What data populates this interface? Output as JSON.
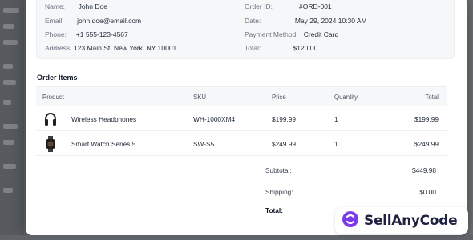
{
  "customer": {
    "name_label": "Name:",
    "name_value": "John Doe",
    "email_label": "Email:",
    "email_value": "john.doe@email.com",
    "phone_label": "Phone:",
    "phone_value": "+1 555-123-4567",
    "address_label": "Address:",
    "address_value": "123 Main St, New York, NY 10001"
  },
  "order": {
    "id_label": "Order ID:",
    "id_value": "#ORD-001",
    "date_label": "Date:",
    "date_value": "May 29, 2024 10:30 AM",
    "payment_label": "Payment Method:",
    "payment_value": "Credit Card",
    "total_label": "Total:",
    "total_value": "$120.00"
  },
  "items_section": {
    "title": "Order Items",
    "headers": {
      "product": "Product",
      "sku": "SKU",
      "price": "Price",
      "quantity": "Quantity",
      "total": "Total"
    },
    "rows": [
      {
        "icon": "headphones-icon",
        "name": "Wireless Headphones",
        "sku": "WH-1000XM4",
        "price": "$199.99",
        "quantity": "1",
        "total": "$199.99"
      },
      {
        "icon": "smartwatch-icon",
        "name": "Smart Watch Series 5",
        "sku": "SW-S5",
        "price": "$249.99",
        "quantity": "1",
        "total": "$249.99"
      }
    ]
  },
  "summary": {
    "subtotal_label": "Subtotal:",
    "subtotal_value": "$449.98",
    "shipping_label": "Shipping:",
    "shipping_value": "$0.00",
    "total_label": "Total:"
  },
  "watermark": {
    "text": "SellAnyCode",
    "accent": "#7c3aed"
  }
}
